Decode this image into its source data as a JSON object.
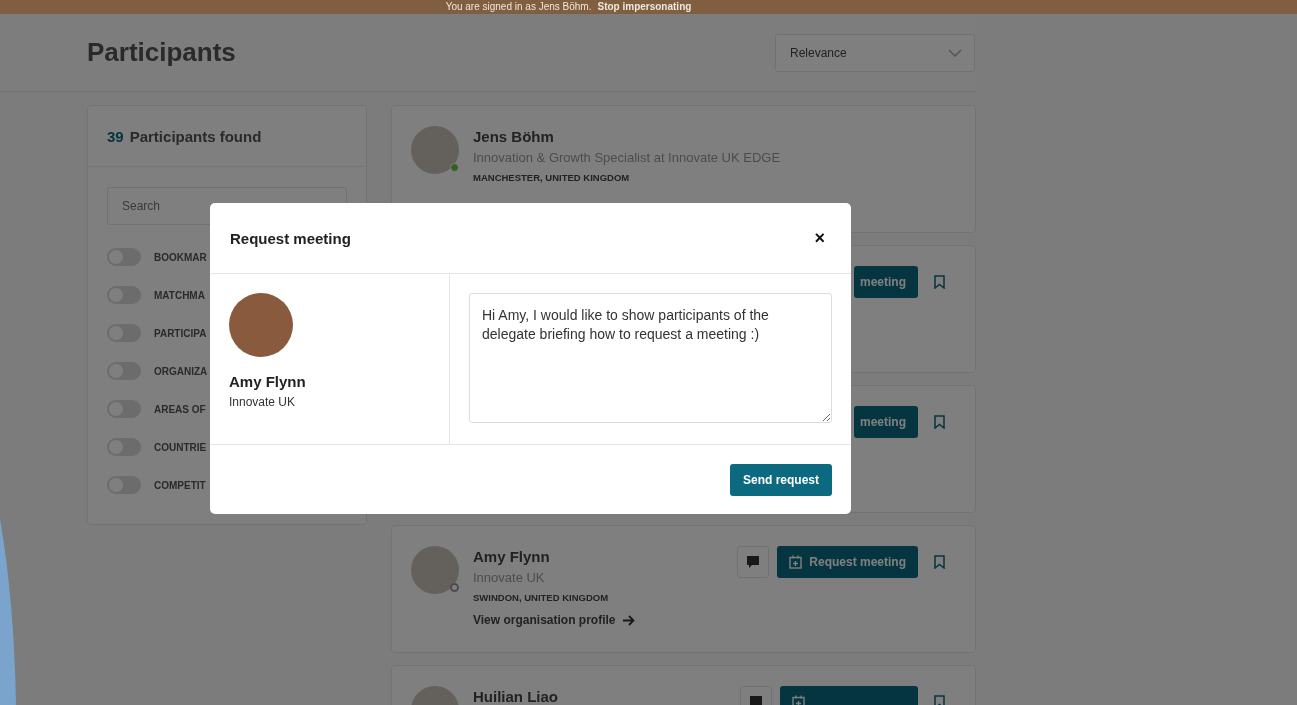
{
  "banner": {
    "text": "You are signed in as Jens Böhm.",
    "link": "Stop impersonating"
  },
  "header": {
    "title": "Participants",
    "sort": "Relevance"
  },
  "sidebar": {
    "count": "39",
    "count_label": "Participants found",
    "search": {
      "placeholder": "Search"
    },
    "filters": [
      {
        "label": "BOOKMAR",
        "on": false
      },
      {
        "label": "MATCHMA",
        "on": false
      },
      {
        "label": "PARTICIPA",
        "on": false
      },
      {
        "label": "ORGANIZA",
        "on": false
      },
      {
        "label": "AREAS OF",
        "on": false
      },
      {
        "label": "COUNTRIE",
        "on": false
      },
      {
        "label": "COMPETIT",
        "on": false
      }
    ]
  },
  "cards": [
    {
      "kind": "self",
      "name": "Jens Böhm",
      "subtitle": "Innovation & Growth Specialist at Innovate UK EDGE",
      "location": "MANCHESTER, UNITED KINGDOM",
      "online": true
    },
    {
      "kind": "covered",
      "request_label": "meeting"
    },
    {
      "kind": "covered",
      "request_label": "meeting"
    },
    {
      "kind": "other",
      "name": "Amy Flynn",
      "subtitle": "Innovate UK",
      "location": "SWINDON, UNITED KINGDOM",
      "link": "View organisation profile",
      "online": false,
      "request_label": "Request meeting"
    },
    {
      "kind": "other",
      "name": "Huilian Liao"
    }
  ],
  "modal": {
    "title": "Request meeting",
    "close": "×",
    "person_name": "Amy Flynn",
    "person_org": "Innovate UK",
    "message": "Hi Amy, I would like to show participants of the delegate briefing how to request a meeting :)",
    "button": "Send request"
  }
}
